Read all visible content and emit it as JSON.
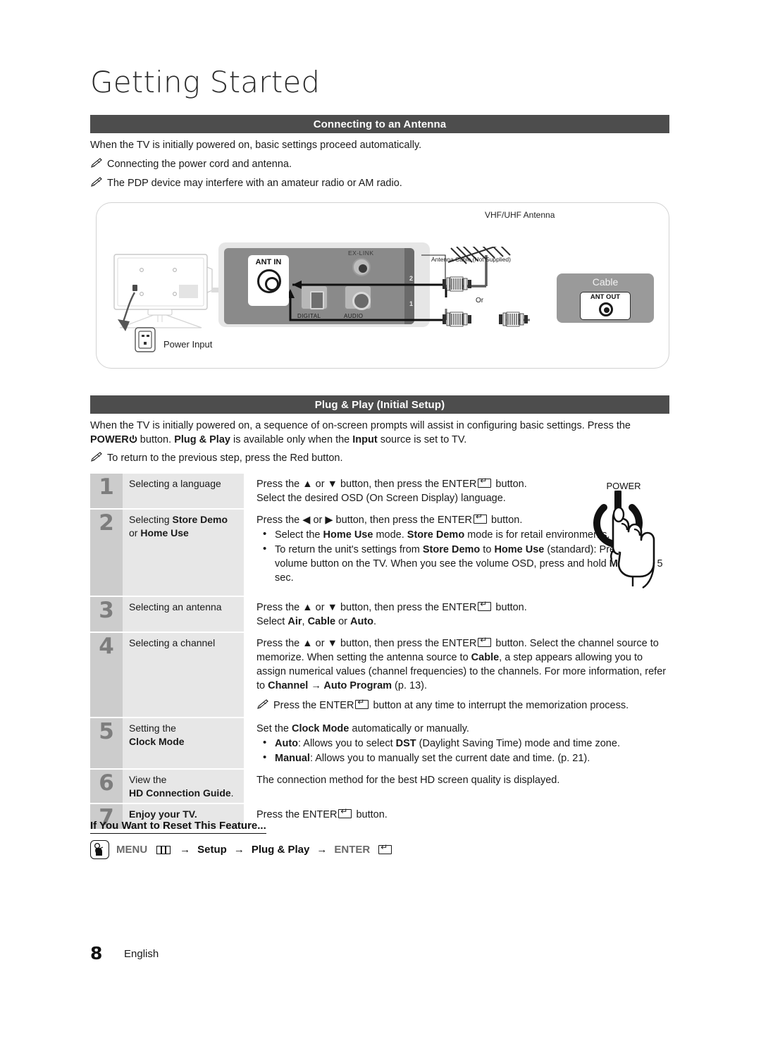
{
  "chapter": {
    "title": "Getting Started"
  },
  "sections": {
    "antenna": {
      "heading": "Connecting to an Antenna",
      "intro": "When the TV is initially powered on, basic settings proceed automatically.",
      "notes": [
        "Connecting the power cord and antenna.",
        "The PDP device may interfere with an amateur radio or AM radio."
      ],
      "diagram": {
        "antenna_label": "VHF/UHF Antenna",
        "cable_label": "Antenna Cable (Not Supplied)",
        "or_label": "Or",
        "ant_in": "ANT IN",
        "ant_out": "ANT OUT",
        "cable_box": "Cable",
        "power_input": "Power Input",
        "exlink": "EX-LINK",
        "digital": "DIGITAL",
        "audio": "AUDIO",
        "port_num_top": "2",
        "port_num_bottom": "1"
      }
    },
    "plugplay": {
      "heading": "Plug & Play (Initial Setup)",
      "intro_part1": "When the TV is initially powered on, a sequence of on-screen prompts will assist in configuring basic settings. Press the ",
      "intro_power": "POWER",
      "intro_part2": " button. ",
      "intro_bold1": "Plug & Play",
      "intro_part3": " is available only when the ",
      "intro_bold2": "Input",
      "intro_part4": " source is set to TV.",
      "note": "To return to the previous step, press the Red button.",
      "power_illustration_label": "POWER",
      "steps": [
        {
          "num": "1",
          "label_plain": "Selecting a language",
          "lines": [
            "Press the ▲ or ▼ button, then press the ENTER",
            " button.",
            "Select the desired OSD (On Screen Display) language."
          ]
        },
        {
          "num": "2",
          "label_pre": "Selecting ",
          "label_bold": "Store Demo",
          "label_mid": "or ",
          "label_bold2": "Home Use",
          "intro": "Press the ◀ or ▶ button, then press the ENTER",
          "intro_tail": " button.",
          "bullets": [
            {
              "pre": "Select the ",
              "b1": "Home Use",
              "mid": " mode. ",
              "b2": "Store Demo",
              "post": " mode is for retail environments."
            },
            {
              "pre": "To return the unit's settings from ",
              "b1": "Store Demo",
              "mid": " to ",
              "b2": "Home Use",
              "post": " (standard): Press the volume button on the TV. When you see the volume OSD, press and hold ",
              "b3": "MENU",
              "post2": " for 5 sec."
            }
          ]
        },
        {
          "num": "3",
          "label_plain": "Selecting an antenna",
          "intro": "Press the ▲ or ▼ button, then press the ENTER",
          "intro_tail": " button.",
          "line2_pre": "Select ",
          "line2_b1": "Air",
          "line2_m1": ", ",
          "line2_b2": "Cable",
          "line2_m2": " or ",
          "line2_b3": "Auto",
          "line2_end": "."
        },
        {
          "num": "4",
          "label_plain": "Selecting a channel",
          "intro": "Press the ▲ or ▼ button, then press the ENTER",
          "intro_tail": " button. Select the channel source to memorize. When setting the antenna source to ",
          "b_cable": "Cable",
          "tail2": ", a step appears allowing you to assign numerical values (channel frequencies) to the channels. For more information, refer to ",
          "b_channel": "Channel",
          "arrow": " → ",
          "b_autoprog": "Auto Program",
          "tail3": " (p. 13).",
          "note_pre": "Press the ENTER",
          "note_post": " button at any time to interrupt the memorization process."
        },
        {
          "num": "5",
          "label_line1": "Setting the",
          "label_bold": "Clock Mode",
          "intro_pre": "Set the ",
          "intro_b": "Clock Mode",
          "intro_post": " automatically or manually.",
          "bullets": [
            {
              "b": "Auto",
              "pre": ": Allows you to select ",
              "b2": "DST",
              "post": " (Daylight Saving Time) mode and time zone."
            },
            {
              "b": "Manual",
              "pre": ": Allows you to manually set the current date and time. (p. 21).",
              "b2": "",
              "post": ""
            }
          ]
        },
        {
          "num": "6",
          "label_line1": "View the",
          "label_bold": "HD Connection Guide",
          "label_tail": ".",
          "body": "The connection method for the best HD screen quality is displayed."
        },
        {
          "num": "7",
          "label_bold_only": "Enjoy your TV.",
          "body_pre": "Press the ENTER",
          "body_post": " button."
        }
      ]
    },
    "reset": {
      "heading": "If You Want to Reset This Feature...",
      "path_menu": "MENU",
      "arrow": "→",
      "path_setup": "Setup",
      "path_plugplay": "Plug & Play",
      "path_enter": "ENTER"
    }
  },
  "footer": {
    "page_number": "8",
    "language": "English"
  },
  "colors": {
    "bar_bg": "#4d4d4d",
    "step_num_bg": "#cccccc",
    "step_label_bg": "#e7e7e7",
    "panel_gray": "#8a8a8a",
    "cable_box_gray": "#9a9a9a"
  }
}
